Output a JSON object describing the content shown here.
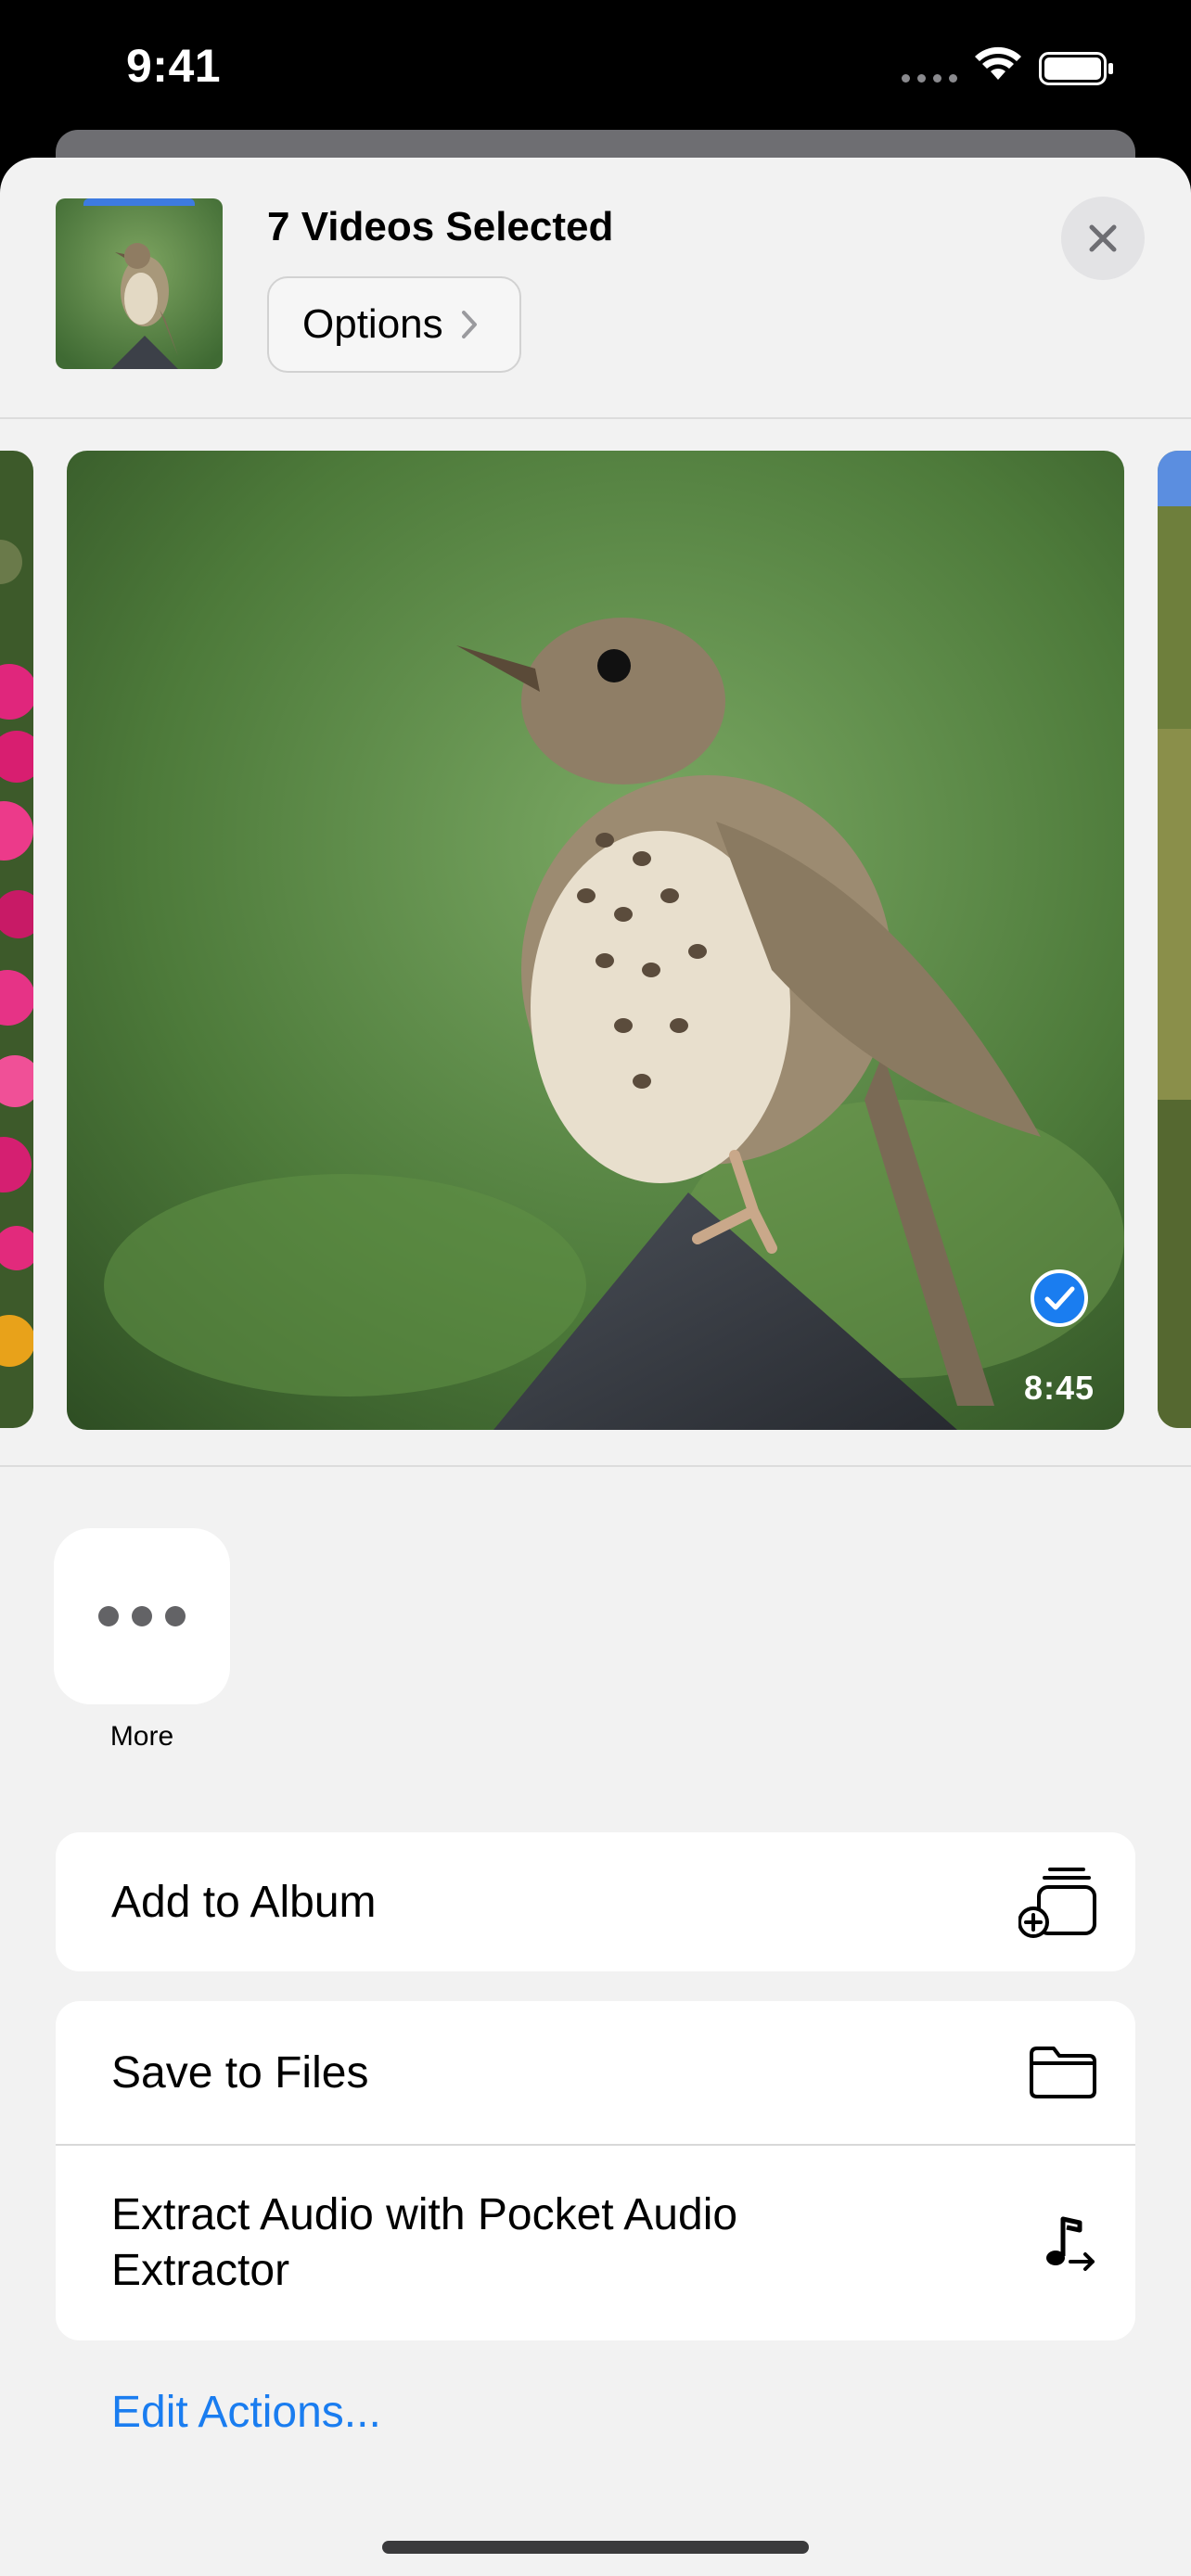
{
  "status_bar": {
    "time": "9:41"
  },
  "header": {
    "title": "7 Videos Selected",
    "options_label": "Options"
  },
  "media": {
    "duration": "8:45",
    "selected": true
  },
  "actions_row": [
    {
      "label": "More",
      "icon": "ellipsis-icon"
    }
  ],
  "action_groups": [
    [
      {
        "label": "Add to Album",
        "icon": "add-to-album-icon"
      }
    ],
    [
      {
        "label": "Save to Files",
        "icon": "folder-icon"
      },
      {
        "label": "Extract Audio with Pocket Audio Extractor",
        "icon": "music-note-arrow-icon"
      }
    ]
  ],
  "edit_actions_label": "Edit Actions...",
  "colors": {
    "accent": "#1a7df0",
    "sheet_background": "#f2f2f2",
    "card_background": "#ffffff"
  }
}
